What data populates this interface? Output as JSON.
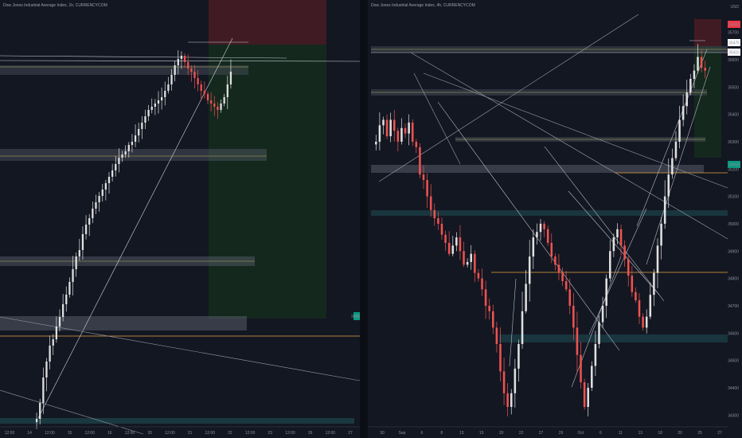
{
  "colors": {
    "background": "#131722",
    "candle_up": "#e0e0e0",
    "candle_down": "#ef5350",
    "zone_gray": "#5d6270",
    "zone_teal": "#1f4f55",
    "zone_olive": "#8a8a50",
    "orange_line": "#e8a33c",
    "green_tag": "#089981",
    "red_tag": "#f23645"
  },
  "left_chart": {
    "title": "Dow Jones Industrial Average Index, 1h, CURRENCYCOM",
    "x_ticks": [
      "12:00",
      "14",
      "12:00",
      "15",
      "12:00",
      "16",
      "12:00",
      "20",
      "12:00",
      "21",
      "12:00",
      "22",
      "12:00",
      "23",
      "12:00",
      "26",
      "12:00",
      "27"
    ],
    "price_tag": "34965"
  },
  "right_chart": {
    "title": "Dow Jones Industrial Average Index, 4h, CURRENCYCOM",
    "header_label": "USD",
    "x_ticks": [
      "30",
      "Sep",
      "6",
      "8",
      "13",
      "15",
      "20",
      "22",
      "27",
      "29",
      "Oct",
      "6",
      "11",
      "13",
      "18",
      "20",
      "25",
      "27"
    ],
    "y_ticks": [
      "35700",
      "35600",
      "35500",
      "35400",
      "35300",
      "35200",
      "35100",
      "35000",
      "34900",
      "34800",
      "34700",
      "34600",
      "34500",
      "34400",
      "34300"
    ],
    "price_tags": [
      "35600",
      "35475",
      "35415",
      "34965"
    ]
  },
  "chart_data": [
    {
      "type": "candlestick",
      "title": "Dow Jones Industrial Average Index, 1h, CURRENCYCOM",
      "x_tick_labels": [
        "12:00",
        "14",
        "12:00",
        "15",
        "12:00",
        "16",
        "12:00",
        "20",
        "12:00",
        "21",
        "12:00",
        "22",
        "12:00",
        "23",
        "12:00",
        "26",
        "12:00",
        "27"
      ],
      "current_price_tag": "34965",
      "close_profile": [
        34470,
        34520,
        34600,
        34650,
        34700,
        34720,
        34760,
        34790,
        34830,
        34860,
        34900,
        34940,
        34980,
        35000,
        35050,
        35080,
        35100,
        35130,
        35150,
        35170,
        35190,
        35210,
        35230,
        35250,
        35270,
        35290,
        35300,
        35310,
        35330,
        35340,
        35360,
        35380,
        35400,
        35420,
        35440,
        35450,
        35460,
        35470,
        35480,
        35500,
        35520,
        35550,
        35580,
        35600,
        35610,
        35590,
        35570,
        35560,
        35540,
        35520,
        35500,
        35490,
        35470,
        35460,
        35450,
        35440,
        35460,
        35480,
        35520,
        35560
      ]
    },
    {
      "type": "candlestick",
      "title": "Dow Jones Industrial Average Index, 4h, CURRENCYCOM",
      "unit": "USD",
      "x_tick_labels": [
        "30",
        "Sep",
        "6",
        "8",
        "13",
        "15",
        "20",
        "22",
        "27",
        "29",
        "Oct",
        "6",
        "11",
        "13",
        "18",
        "20",
        "25",
        "27"
      ],
      "y_tick_labels": [
        "35700",
        "35600",
        "35500",
        "35400",
        "35300",
        "35200",
        "35100",
        "35000",
        "34900",
        "34800",
        "34700",
        "34600",
        "34500",
        "34400",
        "34300"
      ],
      "ylim": [
        34260,
        35760
      ],
      "current_price_tags": [
        "35600",
        "35475",
        "35415",
        "34965"
      ],
      "close_profile": [
        35300,
        35360,
        35380,
        35320,
        35380,
        35340,
        35300,
        35350,
        35330,
        35370,
        35300,
        35280,
        35180,
        35160,
        35100,
        35050,
        35020,
        35000,
        34960,
        34930,
        34890,
        34920,
        34950,
        34900,
        34850,
        34860,
        34890,
        34820,
        34800,
        34760,
        34700,
        34680,
        34620,
        34560,
        34460,
        34380,
        34330,
        34380,
        34470,
        34560,
        34680,
        34780,
        34880,
        34950,
        34970,
        35000,
        34980,
        34930,
        34880,
        34850,
        34820,
        34790,
        34760,
        34700,
        34620,
        34520,
        34420,
        34330,
        34400,
        34480,
        34560,
        34640,
        34700,
        34800,
        34900,
        34950,
        34980,
        34920,
        34870,
        34810,
        34750,
        34720,
        34660,
        34620,
        34660,
        34740,
        34820,
        34920,
        35000,
        35100,
        35180,
        35240,
        35300,
        35380,
        35430,
        35480,
        35530,
        35560,
        35610,
        35570,
        35560
      ]
    }
  ]
}
